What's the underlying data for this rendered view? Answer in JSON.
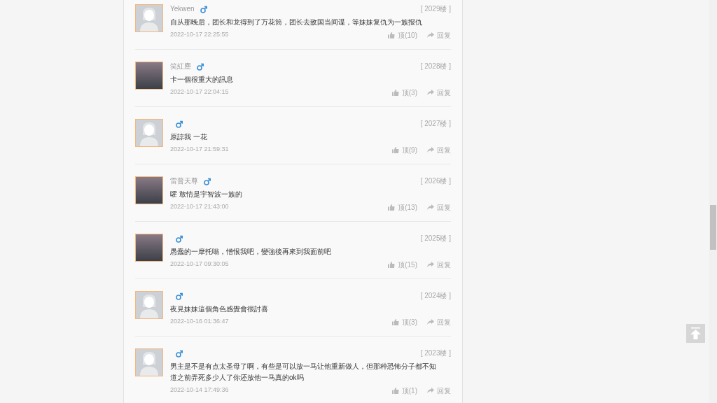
{
  "comments": [
    {
      "avatar": {
        "kind": "default"
      },
      "name": "Yekwen",
      "floor": "[ 2029楼 ]",
      "text": "自从那晚后，团长和龙得到了万花筒，团长去敌国当间谍，等妹妹复仇为一族报仇",
      "time": "2022-10-17 22:25:55",
      "likes": "顶(10)",
      "reply": "回复"
    },
    {
      "avatar": {
        "kind": "photo"
      },
      "name": "笑紅塵",
      "floor": "[ 2028楼 ]",
      "text": "卡一個很重大的訊息",
      "time": "2022-10-17 22:04:15",
      "likes": "顶(3)",
      "reply": "回复"
    },
    {
      "avatar": {
        "kind": "default"
      },
      "floor": "[ 2027楼 ]",
      "text": "原諒我 一花",
      "time": "2022-10-17 21:59:31",
      "likes": "顶(9)",
      "reply": "回复"
    },
    {
      "avatar": {
        "kind": "photo"
      },
      "name": "雷普天尊",
      "floor": "[ 2026楼 ]",
      "text": "嚯 敢情是宇智波一族的",
      "time": "2022-10-17 21:43:00",
      "likes": "顶(13)",
      "reply": "回复"
    },
    {
      "avatar": {
        "kind": "photo"
      },
      "floor": "[ 2025楼 ]",
      "text": "愚蠢的一摩托嗡，憎恨我吧，變強後再來到我面前吧",
      "time": "2022-10-17 09:30:05",
      "likes": "顶(15)",
      "reply": "回复"
    },
    {
      "avatar": {
        "kind": "default"
      },
      "floor": "[ 2024楼 ]",
      "text": "夜見妹妹這個角色感覺會很討喜",
      "time": "2022-10-16 01:36:47",
      "likes": "顶(3)",
      "reply": "回复"
    },
    {
      "avatar": {
        "kind": "default"
      },
      "floor": "[ 2023楼 ]",
      "text": "男主是不是有点太圣母了啊，有些是可以放一马让他重新做人，但那种恐怖分子都不知道之前弄死多少人了你还放他一马真的ok吗",
      "time": "2022-10-14 17:49:36",
      "likes": "顶(1)",
      "reply": "回复"
    }
  ]
}
